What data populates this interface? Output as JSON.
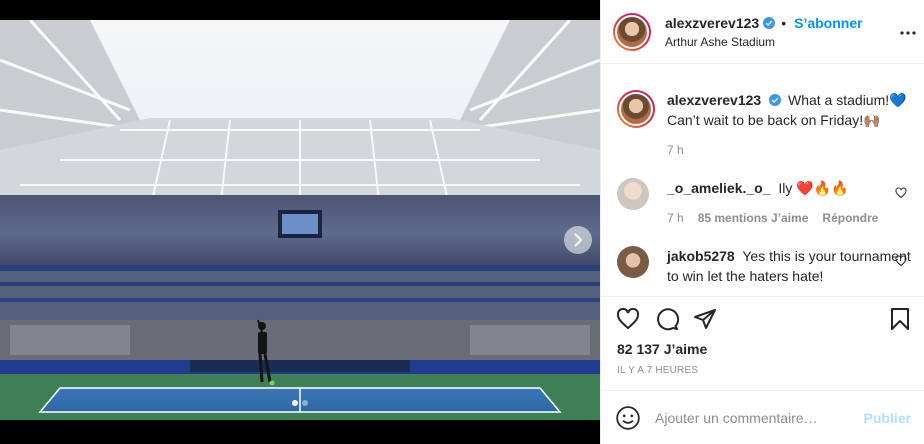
{
  "post": {
    "username": "alexzverev123",
    "follow_label": "S’abonner",
    "location": "Arthur Ashe Stadium",
    "caption_line1": "What a stadium!💙",
    "caption_line2": "Can’t wait to be back on Friday!🙌🏽",
    "caption_age": "7 h",
    "likes_count": "82 137 J’aime",
    "timestamp": "IL Y A 7 HEURES"
  },
  "comments": [
    {
      "username": "_o_ameliek._o_",
      "text": "Ily ❤️🔥🔥",
      "age": "7 h",
      "likes": "85 mentions J’aime",
      "reply": "Répondre"
    },
    {
      "username": "jakob5278",
      "text": "Yes this is your tournament to win let the haters hate!"
    }
  ],
  "add_comment": {
    "placeholder": "Ajouter un commentaire…",
    "publish_label": "Publier"
  },
  "carousel": {
    "slides": 2,
    "current": 1
  },
  "colors": {
    "accent_blue": "#0095f6",
    "verified_blue": "#3897f0",
    "muted_text": "#8e8e8e"
  },
  "icons": [
    "heart-icon",
    "comment-icon",
    "share-icon",
    "bookmark-icon",
    "emoji-icon",
    "more-icon",
    "verified-icon",
    "chevron-right-icon"
  ]
}
